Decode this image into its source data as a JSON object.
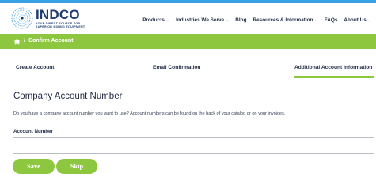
{
  "brand": {
    "name": "INDCO",
    "tagline": "YOUR DIRECT SOURCE FOR SUPERIOR MIXING EQUIPMENT"
  },
  "nav": {
    "items": [
      {
        "label": "Products",
        "dropdown": true
      },
      {
        "label": "Industries We Serve",
        "dropdown": true
      },
      {
        "label": "Blog",
        "dropdown": false
      },
      {
        "label": "Resources & Information",
        "dropdown": true
      },
      {
        "label": "FAQs",
        "dropdown": false
      },
      {
        "label": "About Us",
        "dropdown": true
      }
    ]
  },
  "breadcrumb": {
    "separator": "/",
    "current": "Confirm Account"
  },
  "steps": [
    {
      "label": "Create Account",
      "active": false
    },
    {
      "label": "Email Confirmation",
      "active": false
    },
    {
      "label": "Additional Account Information",
      "active": true
    }
  ],
  "form": {
    "title": "Company Account Number",
    "help": "Do you have a company account number you want to use? Account numbers can be found on the back of your catalog or on your invoices.",
    "account_label": "Account Number",
    "account_value": "",
    "save_label": "Save",
    "skip_label": "Skip"
  },
  "colors": {
    "accent_green": "#8dc63f",
    "top_bar_blue": "#3aa0e6",
    "navy": "#1f3b6e"
  }
}
